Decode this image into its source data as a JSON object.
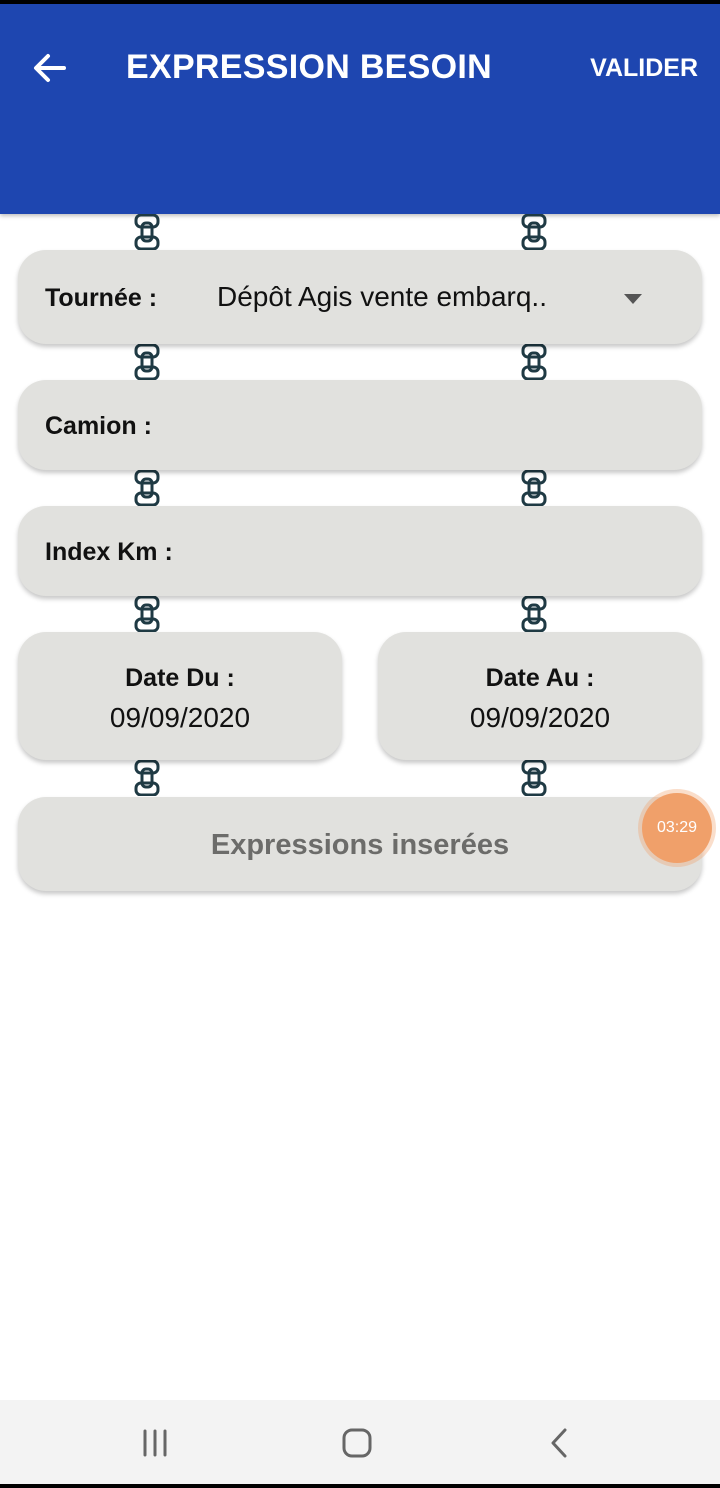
{
  "app_bar": {
    "title": "EXPRESSION BESOIN",
    "action_label": "VALIDER",
    "color": "#1e46b0"
  },
  "form": {
    "tournee": {
      "label": "Tournée :",
      "value": "Dépôt Agis vente embarq.."
    },
    "camion": {
      "label": "Camion :",
      "value": ""
    },
    "index_km": {
      "label": "Index Km :",
      "value": ""
    },
    "date_du": {
      "label": "Date Du :",
      "value": "09/09/2020"
    },
    "date_au": {
      "label": "Date Au :",
      "value": "09/09/2020"
    },
    "expressions_button": {
      "label": "Expressions inserées"
    }
  },
  "timer": {
    "text": "03:29",
    "color": "#f0a06a"
  },
  "nav_bar": {
    "icons": [
      "recent-apps-icon",
      "home-icon",
      "back-nav-icon"
    ]
  }
}
